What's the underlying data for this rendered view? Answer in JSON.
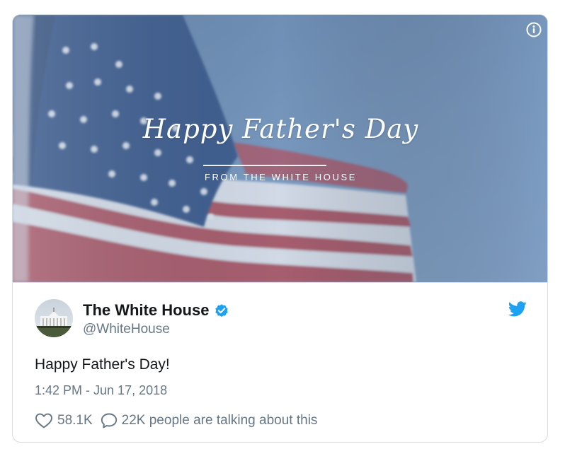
{
  "media": {
    "title": "Happy Father's Day",
    "subtitle": "FROM THE WHITE HOUSE",
    "icons": {
      "info": "info-icon"
    }
  },
  "author": {
    "name": "The White House",
    "handle": "@WhiteHouse",
    "verified": true,
    "icons": {
      "verified": "verified-badge-icon",
      "platform": "twitter-bird-icon"
    }
  },
  "tweet": {
    "text": "Happy Father's Day!",
    "timestamp": "1:42 PM - Jun 17, 2018"
  },
  "actions": {
    "likes": "58.1K",
    "talking": "22K people are talking about this",
    "icons": {
      "like": "heart-icon",
      "reply": "speech-bubble-icon"
    }
  },
  "colors": {
    "twitter_blue": "#1da1f2",
    "text_primary": "#14171a",
    "text_secondary": "#657786",
    "border": "#d6dce0"
  }
}
